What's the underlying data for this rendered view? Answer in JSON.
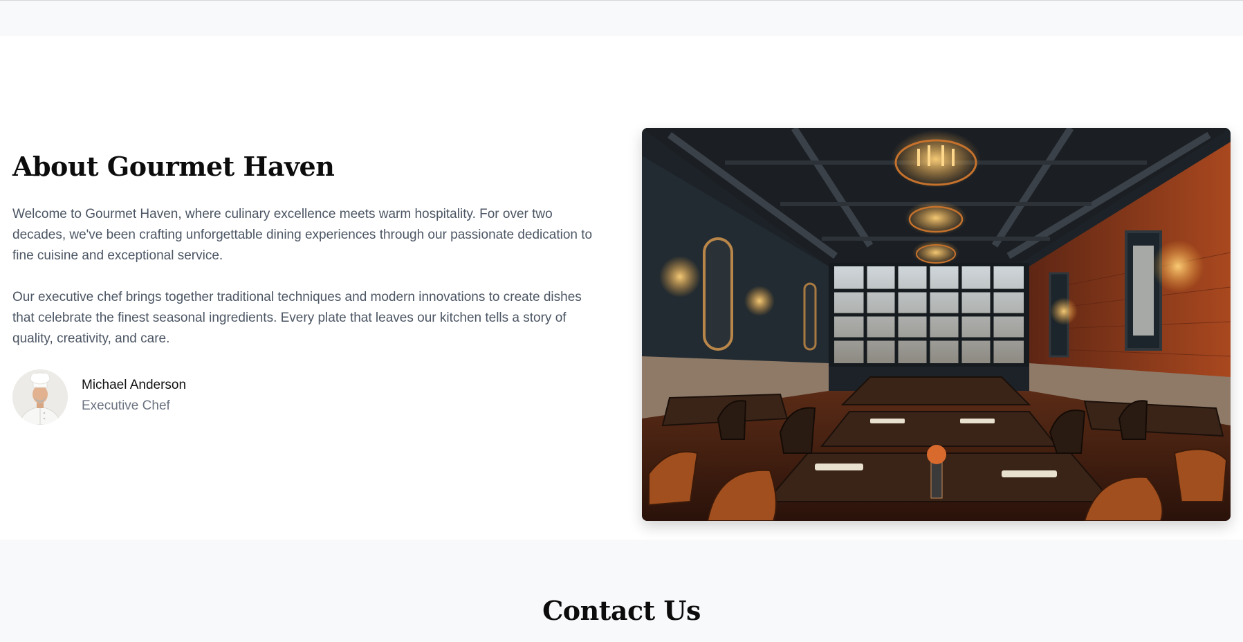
{
  "about": {
    "title": "About Gourmet Haven",
    "paragraph_1": "Welcome to Gourmet Haven, where culinary excellence meets warm hospitality. For over two decades, we've been crafting unforgettable dining experiences through our passionate dedication to fine cuisine and exceptional service.",
    "paragraph_2": "Our executive chef brings together traditional techniques and modern innovations to create dishes that celebrate the finest seasonal ingredients. Every plate that leaves our kitchen tells a story of quality, creativity, and care.",
    "chef": {
      "name": "Michael Anderson",
      "role": "Executive Chef"
    }
  },
  "contact": {
    "title": "Contact Us"
  },
  "colors": {
    "band_background": "#f8f9fb",
    "heading": "#0c0c0c",
    "body_text": "#4b5563",
    "muted_text": "#6b7280",
    "brick": "#8e3a1c",
    "lamp_glow": "#f2a33a"
  },
  "icons": {
    "chef_avatar": "chef-portrait-image",
    "restaurant_photo": "restaurant-interior-image"
  }
}
